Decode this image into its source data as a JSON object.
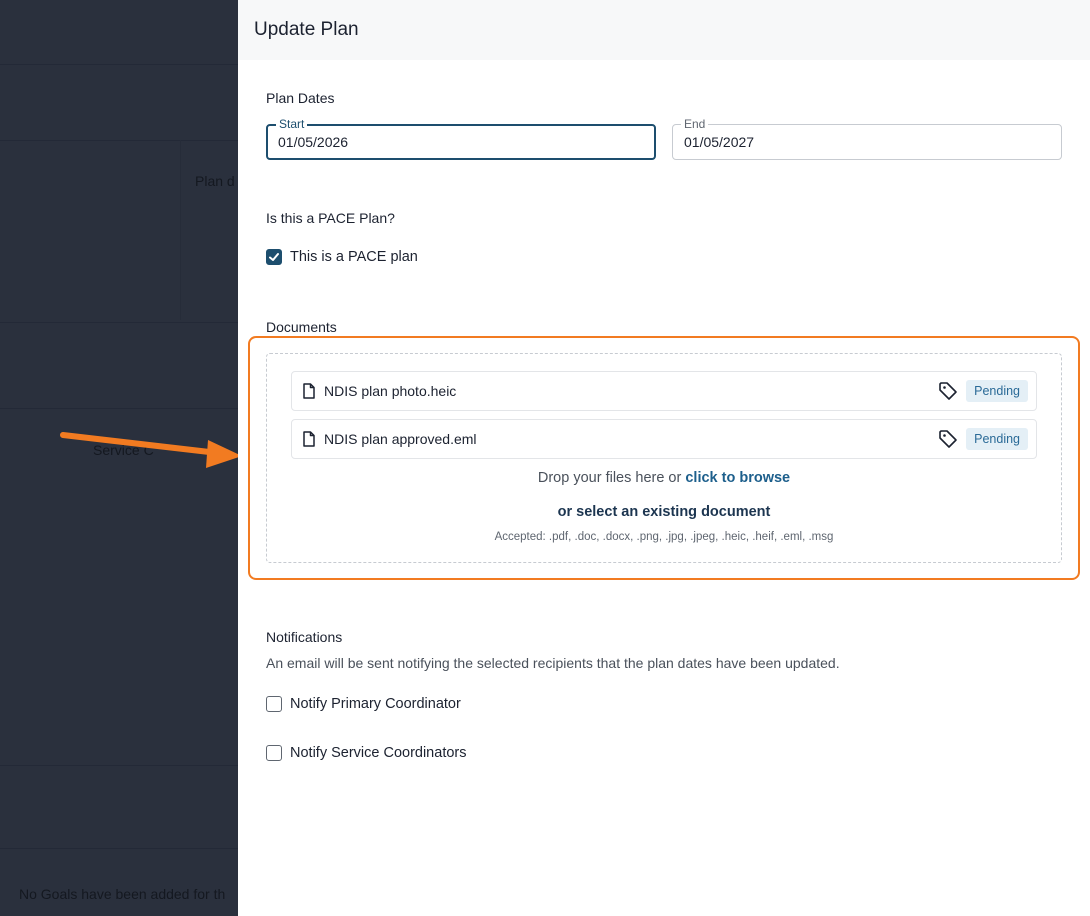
{
  "background": {
    "plan_label_fragment": "Plan d",
    "service_label_fragment": "Service C",
    "no_goals_text": "No Goals have been added for th"
  },
  "drawer": {
    "title": "Update Plan",
    "plan_dates": {
      "heading": "Plan Dates",
      "start_label": "Start",
      "start_value": "01/05/2026",
      "end_label": "End",
      "end_value": "01/05/2027"
    },
    "pace": {
      "heading": "Is this a PACE Plan?",
      "checkbox_label": "This is a PACE plan",
      "checked": true
    },
    "documents": {
      "heading": "Documents",
      "files": [
        {
          "name": "NDIS plan photo.heic",
          "status": "Pending",
          "icon": "file-icon"
        },
        {
          "name": "NDIS plan approved.eml",
          "status": "Pending",
          "icon": "file-icon"
        }
      ],
      "drop_text": "Drop your files here or ",
      "browse_link": "click to browse",
      "select_existing": "or select an existing document",
      "accepted": "Accepted: .pdf, .doc, .docx, .png, .jpg, .jpeg, .heic, .heif, .eml, .msg"
    },
    "notifications": {
      "heading": "Notifications",
      "description": "An email will be sent notifying the selected recipients that the plan dates have been updated.",
      "options": [
        {
          "label": "Notify Primary Coordinator",
          "checked": false
        },
        {
          "label": "Notify Service Coordinators",
          "checked": false
        }
      ]
    }
  },
  "colors": {
    "accent": "#1d4e6e",
    "highlight": "#f27b21",
    "badge_bg": "#e4eff6",
    "badge_text": "#2a6a97"
  }
}
